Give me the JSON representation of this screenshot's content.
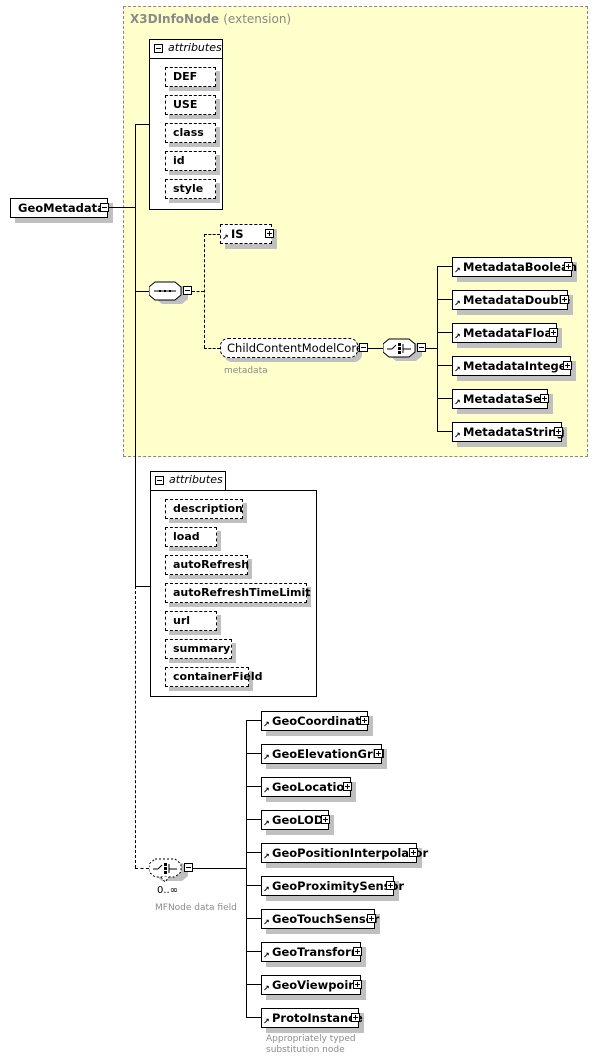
{
  "diagram": {
    "root": {
      "label": "GeoMetadata"
    },
    "extension": {
      "title": "X3DInfoNode",
      "suffix": "(extension)"
    },
    "base_attributes": {
      "title": "attributes",
      "items": [
        "DEF",
        "USE",
        "class",
        "id",
        "style"
      ]
    },
    "sequence": {
      "icon": "sequence-compositor",
      "is_element": {
        "label": "IS"
      },
      "child_group": {
        "label": "ChildContentModelCore",
        "caption": "metadata"
      },
      "choice_items": [
        "MetadataBoolean",
        "MetadataDouble",
        "MetadataFloat",
        "MetadataInteger",
        "MetadataSet",
        "MetadataString"
      ]
    },
    "attributes": {
      "title": "attributes",
      "items": [
        "description",
        "load",
        "autoRefresh",
        "autoRefreshTimeLimit",
        "url",
        "summary",
        "containerField"
      ]
    },
    "children_choice": {
      "multiplicity": "0..∞",
      "caption": "MFNode data field",
      "items": [
        "GeoCoordinate",
        "GeoElevationGrid",
        "GeoLocation",
        "GeoLOD",
        "GeoPositionInterpolator",
        "GeoProximitySensor",
        "GeoTouchSensor",
        "GeoTransform",
        "GeoViewpoint",
        "ProtoInstance"
      ],
      "last_caption_line1": "Appropriately typed",
      "last_caption_line2": "substitution node"
    }
  }
}
